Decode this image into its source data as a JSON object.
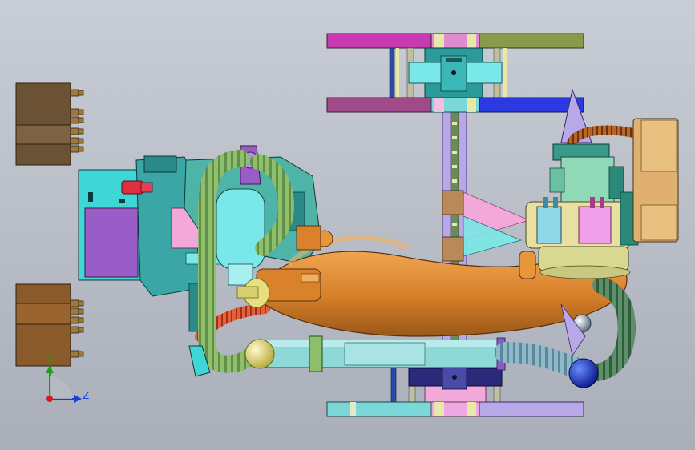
{
  "viewport": {
    "background_top": "#c9cdd5",
    "background_bottom": "#a9aeb9"
  },
  "triad": {
    "y_label": "Y",
    "z_label": "Z",
    "y_color": "#1aa01a",
    "z_color": "#1a3cd8",
    "x_color": "#d81a1a"
  },
  "colors": {
    "block_brown_dark": "#6b5235",
    "block_brown": "#8a5a2a",
    "cyan": "#3fd6d6",
    "teal": "#3aa6a6",
    "violet": "#9a5cc6",
    "pink": "#f2a8d8",
    "orange_arm": "#d9822b",
    "hose_green": "#8fbf6a",
    "hose_dark": "#4f7f5a",
    "rail_magenta": "#c83ab0",
    "rail_olive": "#8a9a4a",
    "rail_blue": "#2a3ae0",
    "light_cyan": "#8fd8e8",
    "yellow_ball": "#e8e080",
    "blue_ball": "#1a3acc",
    "cream": "#e8e0a0",
    "tan": "#e0b070",
    "lavender": "#b8a8e8"
  }
}
